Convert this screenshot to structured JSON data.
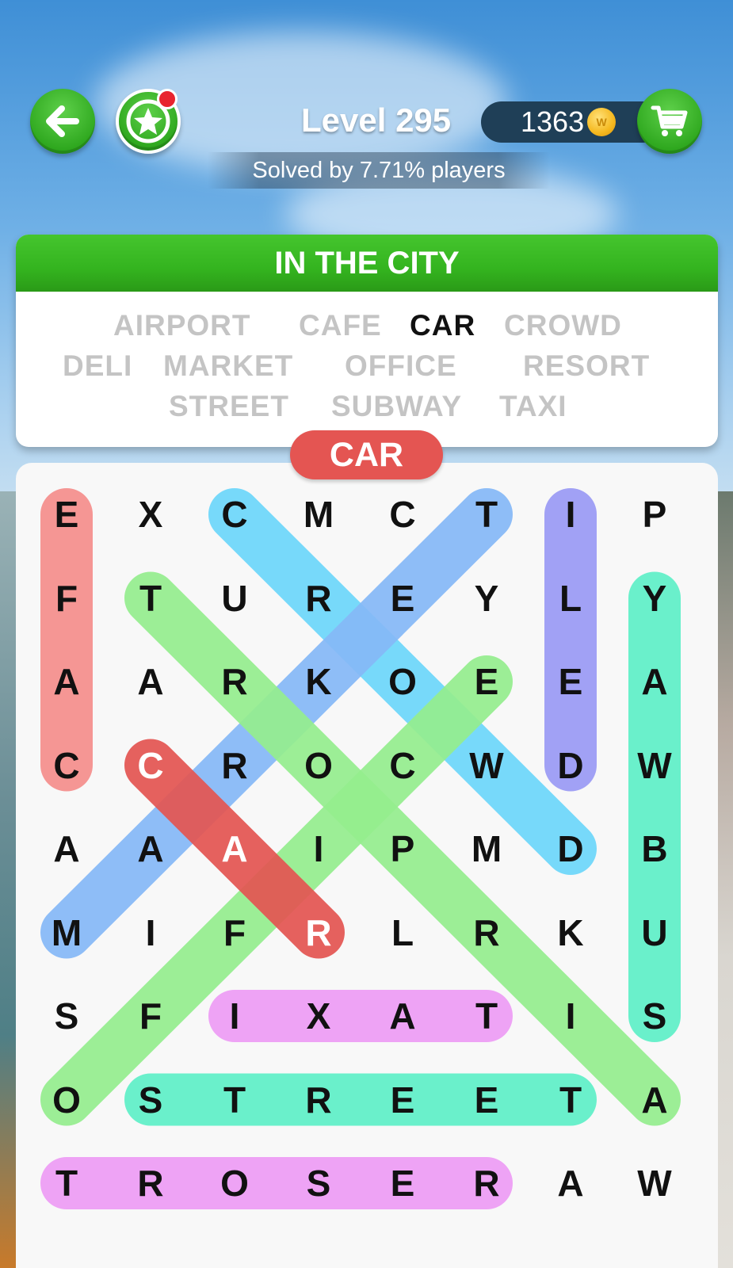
{
  "header": {
    "level_title": "Level 295",
    "solved_text": "Solved by 7.71% players",
    "coins": "1363",
    "coin_symbol": "W"
  },
  "category": {
    "title": "IN THE CITY",
    "words": [
      {
        "text": "AIRPORT",
        "found": false
      },
      {
        "text": "CAFE",
        "found": false
      },
      {
        "text": "CAR",
        "found": true
      },
      {
        "text": "CROWD",
        "found": false
      },
      {
        "text": "DELI",
        "found": false
      },
      {
        "text": "MARKET",
        "found": false
      },
      {
        "text": "OFFICE",
        "found": false
      },
      {
        "text": "RESORT",
        "found": false
      },
      {
        "text": "STREET",
        "found": false
      },
      {
        "text": "SUBWAY",
        "found": false
      },
      {
        "text": "TAXI",
        "found": false
      }
    ]
  },
  "current_word": "CAR",
  "grid": {
    "rows": [
      [
        "E",
        "X",
        "C",
        "M",
        "C",
        "T",
        "I",
        "P"
      ],
      [
        "F",
        "T",
        "U",
        "R",
        "E",
        "Y",
        "L",
        "Y"
      ],
      [
        "A",
        "A",
        "R",
        "K",
        "O",
        "E",
        "E",
        "A"
      ],
      [
        "C",
        "C",
        "R",
        "O",
        "C",
        "W",
        "D",
        "W"
      ],
      [
        "A",
        "A",
        "A",
        "I",
        "P",
        "M",
        "D",
        "B"
      ],
      [
        "M",
        "I",
        "F",
        "R",
        "L",
        "R",
        "K",
        "U"
      ],
      [
        "S",
        "F",
        "I",
        "X",
        "A",
        "T",
        "I",
        "S"
      ],
      [
        "O",
        "S",
        "T",
        "R",
        "E",
        "E",
        "T",
        "A"
      ],
      [
        "T",
        "R",
        "O",
        "S",
        "E",
        "R",
        "A",
        "W"
      ]
    ],
    "highlights": [
      {
        "from": [
          0,
          0
        ],
        "to": [
          3,
          0
        ],
        "color": "#f58e8c"
      },
      {
        "from": [
          0,
          2
        ],
        "to": [
          4,
          6
        ],
        "color": "#6dd7fb"
      },
      {
        "from": [
          0,
          5
        ],
        "to": [
          5,
          0
        ],
        "color": "#86b9f7"
      },
      {
        "from": [
          0,
          6
        ],
        "to": [
          3,
          6
        ],
        "color": "#9a9af5"
      },
      {
        "from": [
          1,
          7
        ],
        "to": [
          6,
          7
        ],
        "color": "#5ef0c8"
      },
      {
        "from": [
          1,
          1
        ],
        "to": [
          7,
          7
        ],
        "color": "#95ee8e"
      },
      {
        "from": [
          2,
          5
        ],
        "to": [
          7,
          0
        ],
        "color": "#95ee8e"
      },
      {
        "from": [
          3,
          1
        ],
        "to": [
          5,
          3
        ],
        "color": "#e45552"
      },
      {
        "from": [
          6,
          2
        ],
        "to": [
          6,
          5
        ],
        "color": "#ee9cf5"
      },
      {
        "from": [
          7,
          1
        ],
        "to": [
          7,
          6
        ],
        "color": "#5ef0c8"
      },
      {
        "from": [
          8,
          0
        ],
        "to": [
          8,
          5
        ],
        "color": "#ee9cf5"
      }
    ],
    "selected_cells": [
      [
        3,
        1
      ],
      [
        4,
        2
      ],
      [
        5,
        3
      ]
    ]
  }
}
